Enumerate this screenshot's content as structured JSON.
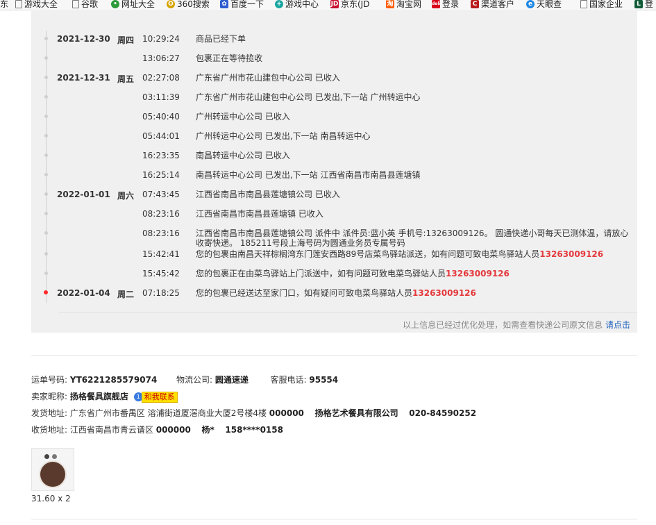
{
  "bookmarks": [
    {
      "label": "东",
      "icon": "none"
    },
    {
      "label": "游戏大全",
      "icon": "page-icon"
    },
    {
      "label": "谷歌",
      "icon": "page-icon"
    },
    {
      "label": "网址大全",
      "icon": "hao123-icon"
    },
    {
      "label": "360搜索",
      "icon": "360-icon"
    },
    {
      "label": "百度一下",
      "icon": "baidu-paw-icon"
    },
    {
      "label": "游戏中心",
      "icon": "game-center-icon"
    },
    {
      "label": "京东(JD",
      "icon": "jd-icon"
    },
    {
      "label": "淘宝网",
      "icon": "taobao-icon"
    },
    {
      "label": "登录",
      "icon": "deli-icon"
    },
    {
      "label": "渠道客户",
      "icon": "channel-icon"
    },
    {
      "label": "天眼查",
      "icon": "tianyancha-icon"
    },
    {
      "label": "国家企业",
      "icon": "page-icon"
    },
    {
      "label": "登",
      "icon": "l-logo-icon"
    }
  ],
  "tracking": {
    "rows": [
      {
        "date": "2021-12-30",
        "day": "周四",
        "time": "10:29:24",
        "desc": "商品已经下单",
        "phone": ""
      },
      {
        "date": "",
        "day": "",
        "time": "13:06:27",
        "desc": "包裹正在等待揽收",
        "phone": ""
      },
      {
        "date": "2021-12-31",
        "day": "周五",
        "time": "02:27:08",
        "desc": "广东省广州市花山建包中心公司 已收入",
        "phone": ""
      },
      {
        "date": "",
        "day": "",
        "time": "03:11:39",
        "desc": "广东省广州市花山建包中心公司 已发出,下一站 广州转运中心",
        "phone": ""
      },
      {
        "date": "",
        "day": "",
        "time": "05:40:40",
        "desc": "广州转运中心公司 已收入",
        "phone": ""
      },
      {
        "date": "",
        "day": "",
        "time": "05:44:01",
        "desc": "广州转运中心公司 已发出,下一站 南昌转运中心",
        "phone": ""
      },
      {
        "date": "",
        "day": "",
        "time": "16:23:35",
        "desc": "南昌转运中心公司 已收入",
        "phone": ""
      },
      {
        "date": "",
        "day": "",
        "time": "16:25:14",
        "desc": "南昌转运中心公司 已发出,下一站 江西省南昌市南昌县莲塘镇",
        "phone": ""
      },
      {
        "date": "2022-01-01",
        "day": "周六",
        "time": "07:43:45",
        "desc": "江西省南昌市南昌县莲塘镇公司 已收入",
        "phone": ""
      },
      {
        "date": "",
        "day": "",
        "time": "08:23:16",
        "desc": "江西省南昌市南昌县莲塘镇 已收入",
        "phone": ""
      },
      {
        "date": "",
        "day": "",
        "time": "08:23:16",
        "desc": "江西省南昌市南昌县莲塘镇公司 派件中 派件员:蓝小英 手机号:13263009126。 圆通快递小哥每天已测体温，请放心收寄快递。 185211号段上海号码为圆通业务员专属号码",
        "phone": ""
      },
      {
        "date": "",
        "day": "",
        "time": "15:42:41",
        "desc": "您的包裹由南昌天祥棕榈湾东门莲安西路89号店菜鸟驿站派送，如有问题可致电菜鸟驿站人员",
        "phone": "13263009126"
      },
      {
        "date": "",
        "day": "",
        "time": "15:45:42",
        "desc": "您的包裹正在由菜鸟驿站上门派送中，如有问题可致电菜鸟驿站人员",
        "phone": "13263009126"
      },
      {
        "date": "2022-01-04",
        "day": "周二",
        "time": "07:18:25",
        "desc": "您的包裹已经送达至家门口，如有疑问可致电菜鸟驿站人员",
        "phone": "13263009126"
      }
    ],
    "note": "以上信息已经过优化处理，如需查看快递公司原文信息",
    "note_link": "请点击"
  },
  "info": {
    "tracking_no_label": "运单号码:",
    "tracking_no": "YT6221285579074",
    "carrier_label": "物流公司:",
    "carrier": "圆通速递",
    "service_label": "客服电话:",
    "service_phone": "95554",
    "seller_label": "卖家昵称:",
    "seller": "扬格餐具旗舰店",
    "chat_count": "1",
    "chat_label": "和我联系",
    "ship_label": "发货地址:",
    "ship_address": "广东省广州市番禺区 溶浦街道厦滘商业大厦2号楼4楼",
    "ship_zip": "000000",
    "ship_company": "扬格艺术餐具有限公司",
    "ship_phone": "020-84590252",
    "recv_label": "收货地址:",
    "recv_address": "江西省南昌市青云谱区",
    "recv_zip": "000000",
    "recv_name": "杨*",
    "recv_phone": "158****0158"
  },
  "product": {
    "price_qty": "31.60 x 2"
  }
}
